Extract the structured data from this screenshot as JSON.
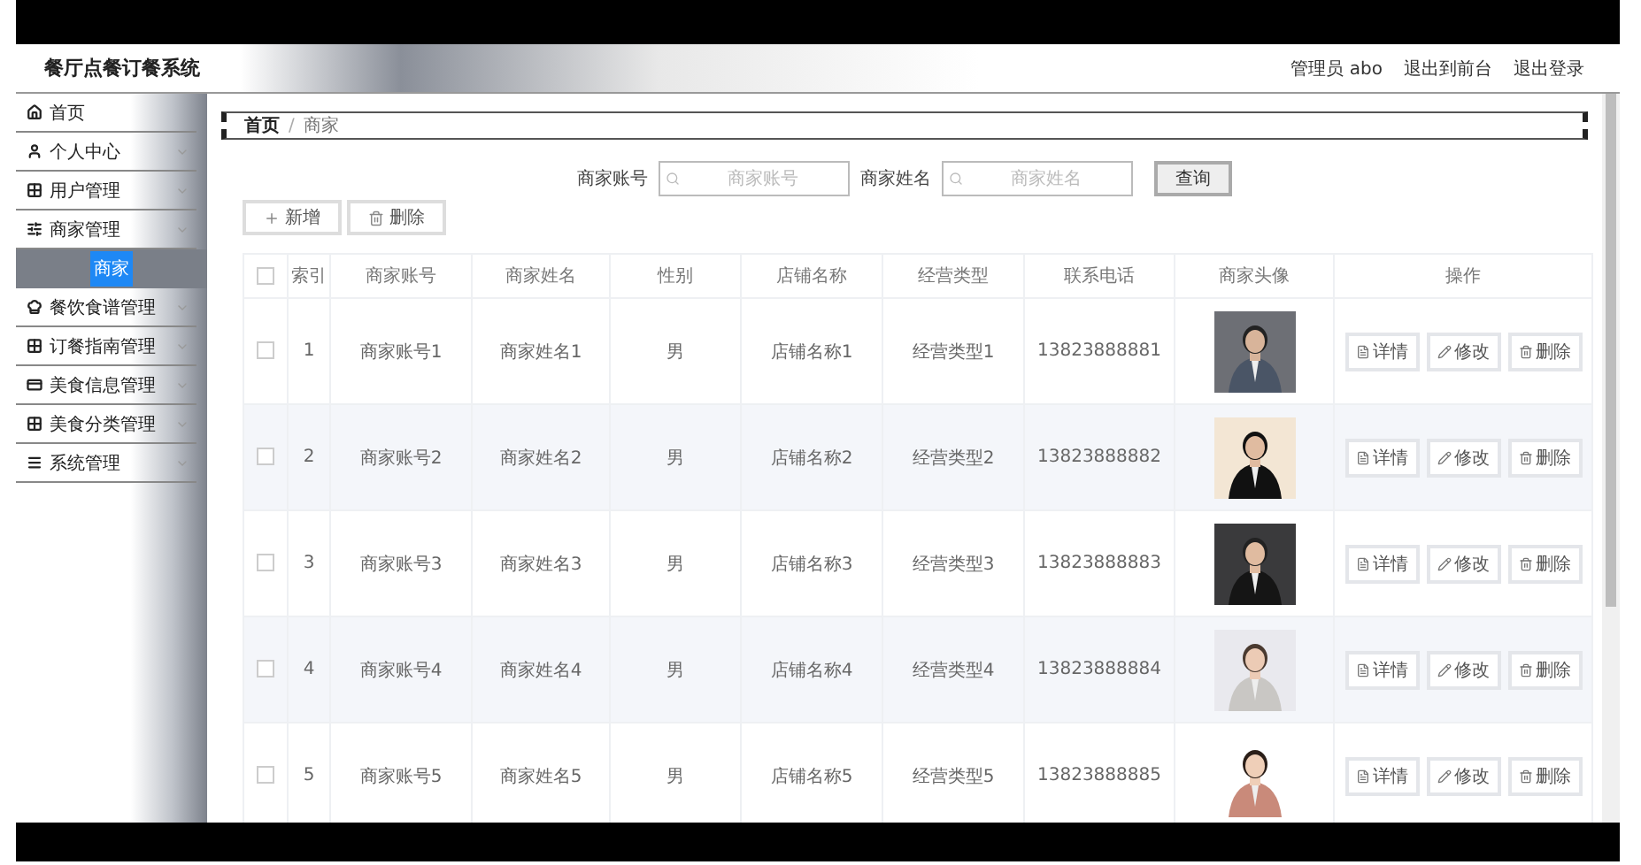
{
  "header": {
    "title": "餐厅点餐订餐系统",
    "links": [
      "管理员 abo",
      "退出到前台",
      "退出登录"
    ]
  },
  "sidebar": {
    "items": [
      {
        "label": "首页",
        "kind": "link"
      },
      {
        "label": "个人中心",
        "kind": "menu"
      },
      {
        "label": "用户管理",
        "kind": "menu"
      },
      {
        "label": "商家管理",
        "kind": "menu",
        "children": [
          {
            "label": "商家",
            "selected": true
          }
        ]
      },
      {
        "label": "餐饮食谱管理",
        "kind": "menu"
      },
      {
        "label": "订餐指南管理",
        "kind": "menu"
      },
      {
        "label": "美食信息管理",
        "kind": "menu"
      },
      {
        "label": "美食分类管理",
        "kind": "menu"
      },
      {
        "label": "系统管理",
        "kind": "menu"
      }
    ]
  },
  "breadcrumb": {
    "items": [
      "首页",
      "商家"
    ],
    "separator": "/"
  },
  "search": {
    "fields": [
      {
        "label": "商家账号",
        "placeholder": "商家账号"
      },
      {
        "label": "商家姓名",
        "placeholder": "商家姓名"
      }
    ],
    "button": "查询"
  },
  "toolbar": [
    "新增",
    "删除"
  ],
  "table": {
    "header_checked": false,
    "columns": [
      "索引",
      "商家账号",
      "商家姓名",
      "性别",
      "店铺名称",
      "经营类型",
      "联系电话",
      "商家头像",
      "操作"
    ],
    "rows": [
      {
        "checked": false,
        "cells": [
          "1",
          "商家账号1",
          "商家姓名1",
          "男",
          "店铺名称1",
          "经营类型1",
          "13823888881"
        ],
        "actions": [
          "详情",
          "修改",
          "删除"
        ]
      },
      {
        "checked": false,
        "cells": [
          "2",
          "商家账号2",
          "商家姓名2",
          "男",
          "店铺名称2",
          "经营类型2",
          "13823888882"
        ],
        "actions": [
          "详情",
          "修改",
          "删除"
        ]
      },
      {
        "checked": false,
        "cells": [
          "3",
          "商家账号3",
          "商家姓名3",
          "男",
          "店铺名称3",
          "经营类型3",
          "13823888883"
        ],
        "actions": [
          "详情",
          "修改",
          "删除"
        ]
      },
      {
        "checked": false,
        "cells": [
          "4",
          "商家账号4",
          "商家姓名4",
          "男",
          "店铺名称4",
          "经营类型4",
          "13823888884"
        ],
        "actions": [
          "详情",
          "修改",
          "删除"
        ]
      },
      {
        "checked": false,
        "cells": [
          "5",
          "商家账号5",
          "商家姓名5",
          "男",
          "店铺名称5",
          "经营类型5",
          "13823888885"
        ],
        "actions": [
          "详情",
          "修改",
          "删除"
        ]
      }
    ]
  }
}
